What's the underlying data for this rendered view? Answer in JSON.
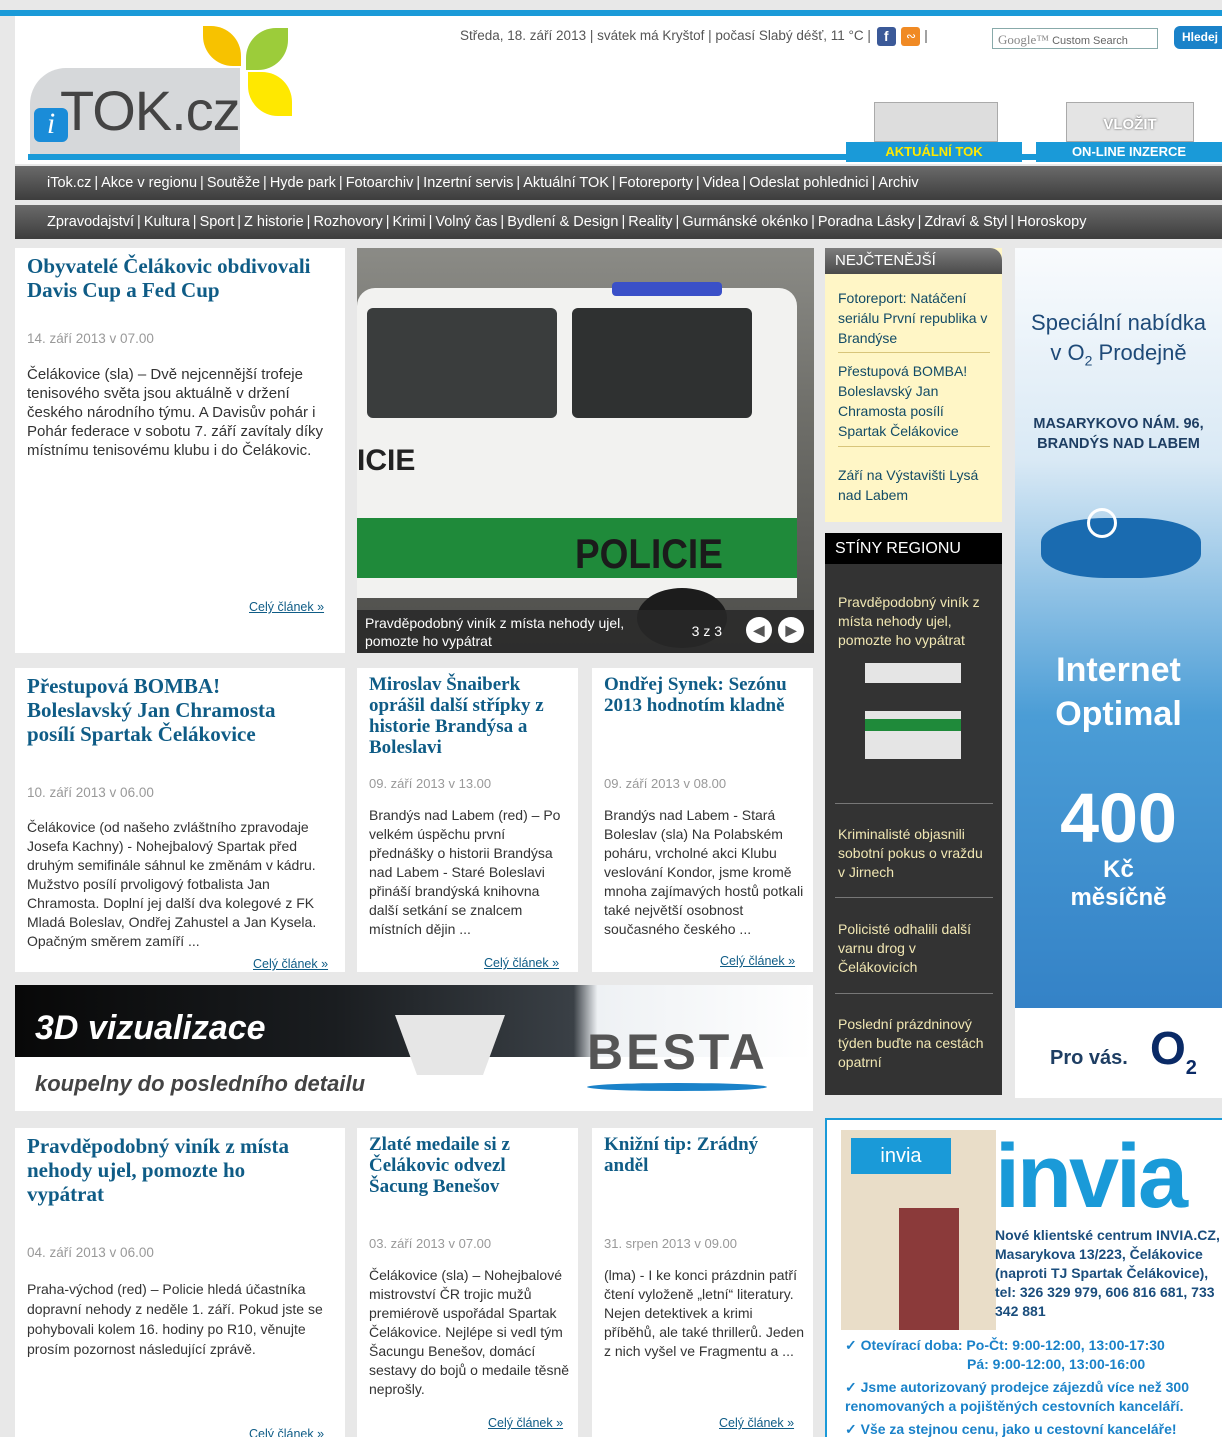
{
  "header": {
    "date_line": "Středa, 18. září 2013 | svátek má Kryštof | počasí Slabý déšť, 11 °C |",
    "facebook": "f",
    "rss": "⌘",
    "search_brand": "Google™",
    "search_placeholder": "Custom Search",
    "search_button": "Hledej",
    "logo_i": "i",
    "logo_text": "TOK.cz",
    "aktualni_label": "AKTUÁLNÍ TOK",
    "vlozit_image": "VLOŽIT",
    "vlozit_label": "ON-LINE INZERCE"
  },
  "nav1": [
    "iTok.cz",
    "Akce v regionu",
    "Soutěže",
    "Hyde park",
    "Fotoarchiv",
    "Inzertní servis",
    "Aktuální TOK",
    "Fotoreporty",
    "Videa",
    "Odeslat pohlednici",
    "Archiv"
  ],
  "nav2": [
    "Zpravodajství",
    "Kultura",
    "Sport",
    "Z historie",
    "Rozhovory",
    "Krimi",
    "Volný čas",
    "Bydlení & Design",
    "Reality",
    "Gurmánské okénko",
    "Poradna Lásky",
    "Zdraví & Styl",
    "Horoskopy"
  ],
  "articles": {
    "a1": {
      "title": "Obyvatelé Čelákovic obdivovali Davis Cup a Fed Cup",
      "date": "14. září 2013 v 07.00",
      "text": "Čelákovice (sla) – Dvě nejcennější trofeje tenisového světa jsou aktuálně v držení českého národního týmu. A Davisův pohár i Pohár federace v sobotu 7. září zavítaly díky místnímu tenisovému klubu i do Čelákovic.",
      "more": "Celý článek »"
    },
    "a2": {
      "title": "Přestupová BOMBA! Boleslavský Jan Chramosta posílí Spartak Čelákovice",
      "date": "10. září 2013 v 06.00",
      "text": "Čelákovice (od našeho zvláštního zpravodaje Josefa Kachny) - Nohejbalový Spartak před druhým semifinále sáhnul ke změnám v kádru. Mužstvo posílí prvoligový fotbalista Jan Chramosta. Doplní jej další dva kolegové z FK Mladá Boleslav, Ondřej Zahustel a Jan Kysela. Opačným směrem zamíří ...",
      "more": "Celý článek »"
    },
    "a3": {
      "title": "Miroslav Šnaiberk oprášil další střípky z historie Brandýsa a Boleslavi",
      "date": "09. září 2013 v 13.00",
      "text": "Brandýs nad Labem (red) – Po velkém úspěchu první přednášky o historii Brandýsa nad Labem - Staré Boleslavi přináší brandýská knihovna další setkání se znalcem místních dějin ...",
      "more": "Celý článek »"
    },
    "a4": {
      "title": "Ondřej Synek: Sezónu 2013 hodnotím kladně",
      "date": "09. září 2013 v 08.00",
      "text": "Brandýs nad Labem - Stará Boleslav (sla) Na Polabském poháru, vrcholné akci Klubu veslování Kondor, jsme kromě mnoha zajímavých hostů potkali také největší osobnost současného českého ...",
      "more": "Celý článek »"
    },
    "a5": {
      "title": "Pravděpodobný viník z místa nehody ujel, pomozte ho vypátrat",
      "date": "04. září 2013 v 06.00",
      "text": "Praha-východ (red) – Policie hledá účastníka dopravní nehody z neděle 1. září. Pokud jste se pohybovali kolem 16. hodiny po R10, věnujte prosím pozornost následující zprávě.",
      "more": "Celý článek »"
    },
    "a6": {
      "title": "Zlaté medaile si z Čelákovic odvezl Šacung Benešov",
      "date": "03. září 2013 v 07.00",
      "text": "Čelákovice (sla) – Nohejbalové mistrovství ČR trojic mužů premiérově uspořádal Spartak Čelákovice. Nejlépe si vedl tým Šacungu Benešov, domácí sestavy do bojů o medaile těsně neprošly.",
      "more": "Celý článek »"
    },
    "a7": {
      "title": "Knižní tip: Zrádný anděl",
      "date": "31. srpen 2013 v 09.00",
      "text": "(lma) - I ke konci prázdnin patří čtení vyloženě „letní“ literatury. Nejen detektivek a krimi příběhů, ale také thrillerů. Jeden z nich vyšel ve Fragmentu a ...",
      "more": "Celý článek »"
    }
  },
  "hero": {
    "caption": "Pravděpodobný viník z místa nehody ujel, pomozte ho vypátrat",
    "counter": "3 z 3",
    "image_text_1": "POLICIE",
    "image_text_2": "ICIE"
  },
  "nejctenejsi": {
    "heading": "NEJČTENĚJŠÍ",
    "items": [
      "Fotoreport: Natáčení seriálu První republika v Brandýse",
      "Přestupová BOMBA! Boleslavský Jan Chramosta posílí Spartak Čelákovice",
      "Září na Výstavišti Lysá nad Labem"
    ]
  },
  "stiny": {
    "heading": "STÍNY REGIONU",
    "items": [
      "Pravděpodobný viník z místa nehody ujel, pomozte ho vypátrat",
      "Kriminalisté objasnili sobotní pokus o vraždu v Jirnech",
      "Policisté odhalili další varnu drog v Čelákovicích",
      "Poslední prázdninový týden buďte na cestách opatrní"
    ],
    "thumb_text": "POLICIE"
  },
  "o2ad": {
    "line1": "Speciální nabídka",
    "line2": "v O",
    "line2_sub": "2",
    "line2_end": " Prodejně",
    "addr1": "MASARYKOVO NÁM. 96,",
    "addr2": "BRANDÝS NAD LABEM",
    "inet1": "Internet",
    "inet2": "Optimal",
    "price": "400",
    "kc": "Kč",
    "mesicne": "měsíčně",
    "pro": "Pro vás.",
    "logo": "O",
    "logo_sub": "2"
  },
  "besta": {
    "line1": "3D vizualizace",
    "line2": "koupelny do posledního detailu",
    "logo": "BESTA"
  },
  "invia": {
    "sign": "invia",
    "logo": "invia",
    "text": "Nové klientské centrum INVIA.CZ, Masarykova 13/223, Čelákovice (naproti TJ Spartak Čelákovice), tel: 326 329 979, 606 816 681, 733 342 881",
    "bullet1": "✓ Otevírací doba: Po-Čt: 9:00-12:00, 13:00-17:30",
    "bullet1b": "Pá: 9:00-12:00, 13:00-16:00",
    "bullet2": "✓ Jsme autorizovaný prodejce zájezdů více než 300 renomovaných a pojištěných cestovních kanceláří.",
    "bullet3": "✓ Vše za stejnou cenu, jako u cestovní kanceláře!"
  }
}
